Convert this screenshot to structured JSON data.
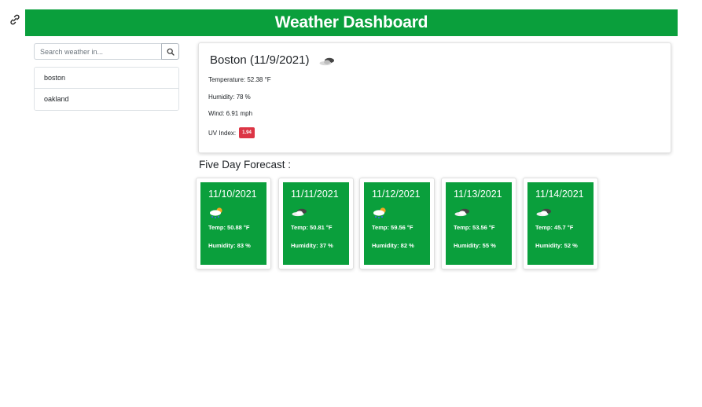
{
  "header": {
    "title": "Weather Dashboard"
  },
  "search": {
    "placeholder": "Search weather in..."
  },
  "history": [
    {
      "label": "boston"
    },
    {
      "label": "oakland"
    }
  ],
  "current": {
    "title": "Boston (11/9/2021)",
    "icon": "cloud-icon",
    "temperature": "Temperature: 52.38 °F",
    "humidity": "Humidity: 78 %",
    "wind": "Wind: 6.91 mph",
    "uv_label": "UV Index:",
    "uv_value": "1.94"
  },
  "forecast": {
    "title": "Five Day Forecast :",
    "days": [
      {
        "date": "11/10/2021",
        "icon": "rain-sun-icon",
        "temp": "Temp: 50.88 °F",
        "humidity": "Humidity: 83 %"
      },
      {
        "date": "11/11/2021",
        "icon": "cloud-icon",
        "temp": "Temp: 50.81 °F",
        "humidity": "Humidity: 37 %"
      },
      {
        "date": "11/12/2021",
        "icon": "rain-sun-icon",
        "temp": "Temp: 59.56 °F",
        "humidity": "Humidity: 82 %"
      },
      {
        "date": "11/13/2021",
        "icon": "cloud-icon",
        "temp": "Temp: 53.56 °F",
        "humidity": "Humidity: 55 %"
      },
      {
        "date": "11/14/2021",
        "icon": "cloud-icon",
        "temp": "Temp: 45.7 °F",
        "humidity": "Humidity: 52 %"
      }
    ]
  },
  "colors": {
    "brand": "#0a9f3c",
    "uv_badge": "#dc3545"
  }
}
